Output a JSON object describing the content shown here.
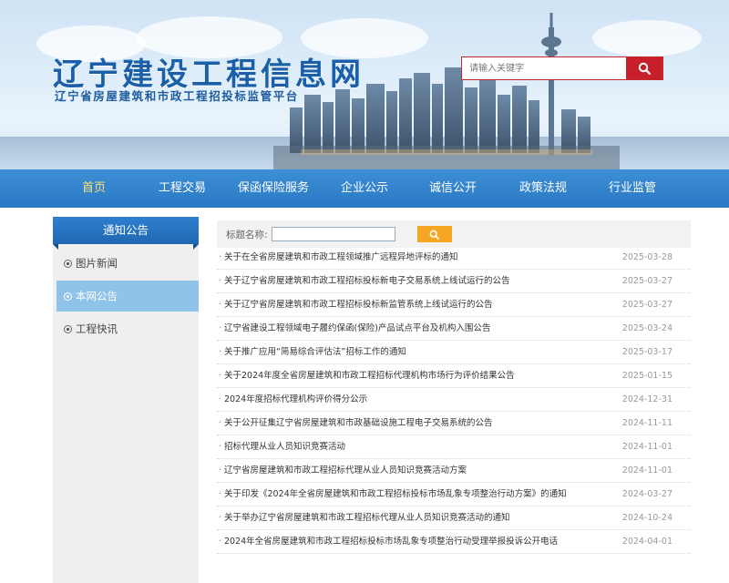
{
  "header": {
    "title": "辽宁建设工程信息网",
    "subtitle": "辽宁省房屋建筑和市政工程招投标监管平台",
    "search_placeholder": "请输入关键字",
    "search_icon": "search-icon"
  },
  "nav": {
    "items": [
      {
        "label": "首页",
        "active": true
      },
      {
        "label": "工程交易"
      },
      {
        "label": "保函保险服务"
      },
      {
        "label": "企业公示"
      },
      {
        "label": "诚信公开"
      },
      {
        "label": "政策法规"
      },
      {
        "label": "行业监管"
      }
    ]
  },
  "sidebar": {
    "header": "通知公告",
    "items": [
      {
        "label": "图片新闻"
      },
      {
        "label": "本网公告",
        "active": true
      },
      {
        "label": "工程快讯"
      }
    ]
  },
  "filter": {
    "label": "标题名称:",
    "button_icon": "search-icon"
  },
  "news": [
    {
      "title": "关于在全省房屋建筑和市政工程领域推广远程异地评标的通知",
      "date": "2025-03-28"
    },
    {
      "title": "关于辽宁省房屋建筑和市政工程招标投标新电子交易系统上线试运行的公告",
      "date": "2025-03-27"
    },
    {
      "title": "关于辽宁省房屋建筑和市政工程招标投标新监管系统上线试运行的公告",
      "date": "2025-03-27"
    },
    {
      "title": "辽宁省建设工程领域电子履约保函(保险)产品试点平台及机构入围公告",
      "date": "2025-03-24"
    },
    {
      "title": "关于推广应用“简易综合评估法”招标工作的通知",
      "date": "2025-03-17"
    },
    {
      "title": "关于2024年度全省房屋建筑和市政工程招标代理机构市场行为评价结果公告",
      "date": "2025-01-15"
    },
    {
      "title": "2024年度招标代理机构评价得分公示",
      "date": "2024-12-31"
    },
    {
      "title": "关于公开征集辽宁省房屋建筑和市政基础设施工程电子交易系统的公告",
      "date": "2024-11-11"
    },
    {
      "title": "招标代理从业人员知识竞赛活动",
      "date": "2024-11-01"
    },
    {
      "title": "辽宁省房屋建筑和市政工程招标代理从业人员知识竞赛活动方案",
      "date": "2024-11-01"
    },
    {
      "title": "关于印发《2024年全省房屋建筑和市政工程招标投标市场乱象专项整治行动方案》的通知",
      "date": "2024-03-27"
    },
    {
      "title": "关于举办辽宁省房屋建筑和市政工程招标代理从业人员知识竞赛活动的通知",
      "date": "2024-10-24"
    },
    {
      "title": "2024年全省房屋建筑和市政工程招标投标市场乱象专项整治行动受理举报投诉公开电话",
      "date": "2024-04-01"
    }
  ],
  "colors": {
    "brand_blue": "#2a78c4",
    "accent_red": "#c8202a",
    "filter_button": "#f5a623",
    "active_side": "#8fc3ea",
    "active_nav": "#ffe07a"
  }
}
